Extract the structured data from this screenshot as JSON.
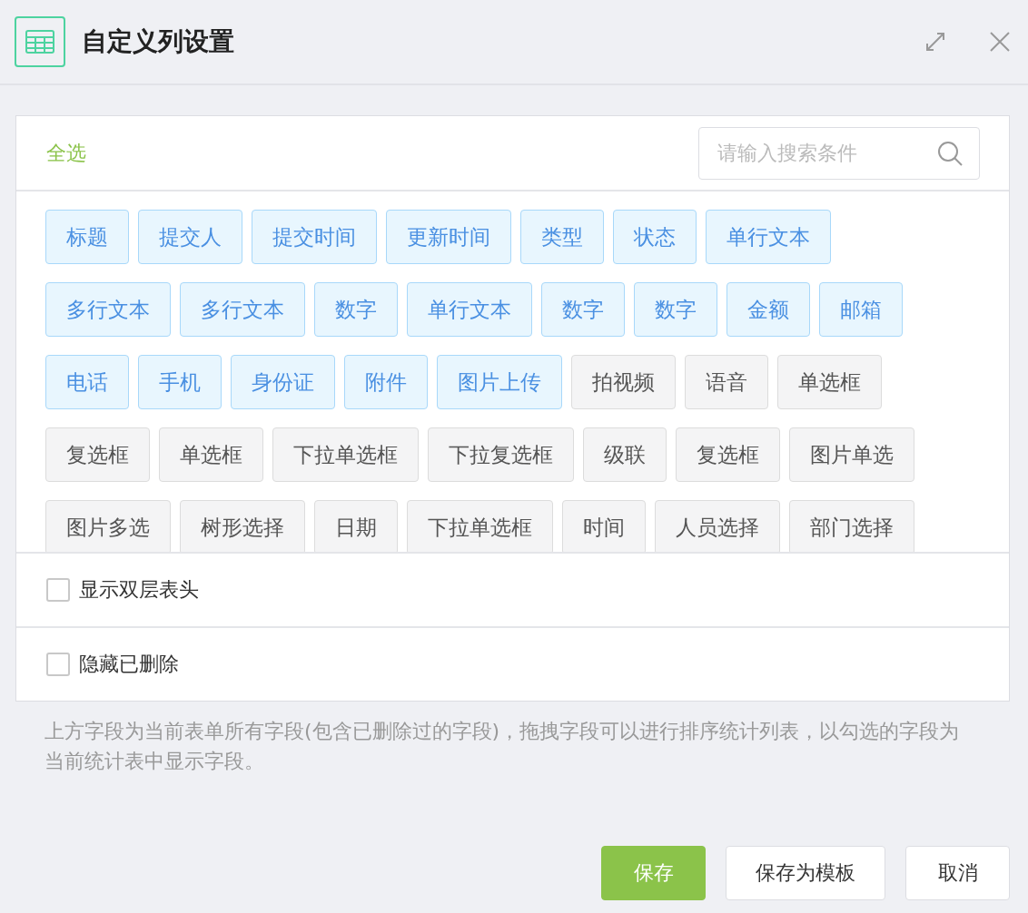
{
  "dialog": {
    "title": "自定义列设置"
  },
  "toolbar": {
    "select_all": "全选",
    "search": {
      "placeholder": "请输入搜索条件"
    }
  },
  "fields": [
    {
      "label": "标题",
      "selected": true
    },
    {
      "label": "提交人",
      "selected": true
    },
    {
      "label": "提交时间",
      "selected": true
    },
    {
      "label": "更新时间",
      "selected": true
    },
    {
      "label": "类型",
      "selected": true
    },
    {
      "label": "状态",
      "selected": true
    },
    {
      "label": "单行文本",
      "selected": true
    },
    {
      "label": "多行文本",
      "selected": true
    },
    {
      "label": "多行文本",
      "selected": true
    },
    {
      "label": "数字",
      "selected": true
    },
    {
      "label": "单行文本",
      "selected": true
    },
    {
      "label": "数字",
      "selected": true
    },
    {
      "label": "数字",
      "selected": true
    },
    {
      "label": "金额",
      "selected": true
    },
    {
      "label": "邮箱",
      "selected": true
    },
    {
      "label": "电话",
      "selected": true
    },
    {
      "label": "手机",
      "selected": true
    },
    {
      "label": "身份证",
      "selected": true
    },
    {
      "label": "附件",
      "selected": true
    },
    {
      "label": "图片上传",
      "selected": true
    },
    {
      "label": "拍视频",
      "selected": false
    },
    {
      "label": "语音",
      "selected": false
    },
    {
      "label": "单选框",
      "selected": false
    },
    {
      "label": "复选框",
      "selected": false
    },
    {
      "label": "单选框",
      "selected": false
    },
    {
      "label": "下拉单选框",
      "selected": false
    },
    {
      "label": "下拉复选框",
      "selected": false
    },
    {
      "label": "级联",
      "selected": false
    },
    {
      "label": "复选框",
      "selected": false
    },
    {
      "label": "图片单选",
      "selected": false
    },
    {
      "label": "图片多选",
      "selected": false
    },
    {
      "label": "树形选择",
      "selected": false
    },
    {
      "label": "日期",
      "selected": false
    },
    {
      "label": "下拉单选框",
      "selected": false
    },
    {
      "label": "时间",
      "selected": false
    },
    {
      "label": "人员选择",
      "selected": false
    },
    {
      "label": "部门选择",
      "selected": false
    }
  ],
  "options": [
    {
      "label": "显示双层表头",
      "checked": false
    },
    {
      "label": "隐藏已删除",
      "checked": false
    }
  ],
  "note": "上方字段为当前表单所有字段(包含已删除过的字段)，拖拽字段可以进行排序统计列表，以勾选的字段为当前统计表中显示字段。",
  "buttons": [
    {
      "label": "保存",
      "kind": "primary"
    },
    {
      "label": "保存为模板",
      "kind": "default"
    },
    {
      "label": "取消",
      "kind": "default"
    }
  ]
}
